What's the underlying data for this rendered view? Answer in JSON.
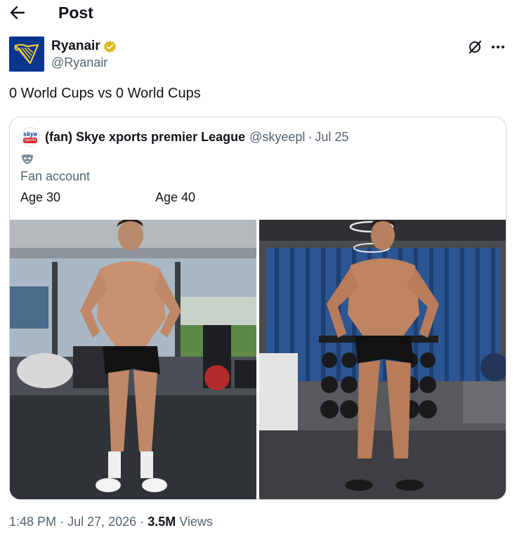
{
  "header": {
    "back_icon": "arrow-left-icon",
    "title": "Post"
  },
  "author": {
    "name": "Ryanair",
    "handle": "@Ryanair",
    "verified_badge": "gold-verified-badge",
    "brand_color": "#073590",
    "accent_color": "#f1c933"
  },
  "actions": {
    "grok_icon": "grok-icon",
    "more_icon": "more-icon"
  },
  "tweet": {
    "text": "0 World Cups vs 0 World Cups"
  },
  "quote": {
    "avatar_text_top": "skye",
    "avatar_text_bottom": "xports",
    "name": "(fan) Skye xports premier League",
    "handle": "@skyeepl",
    "separator": "·",
    "date": "Jul 25",
    "emoji_icon": "mask-emoji-icon",
    "bio": "Fan account",
    "label_left": "Age 30",
    "label_right": "Age 40"
  },
  "meta": {
    "time": "1:48 PM",
    "sep1": "·",
    "date": "Jul 27, 2026",
    "sep2": "·",
    "views_count": "3.5M",
    "views_label": "Views"
  },
  "colors": {
    "text": "#0f1419",
    "secondary": "#536471",
    "border": "#cfd9de"
  }
}
